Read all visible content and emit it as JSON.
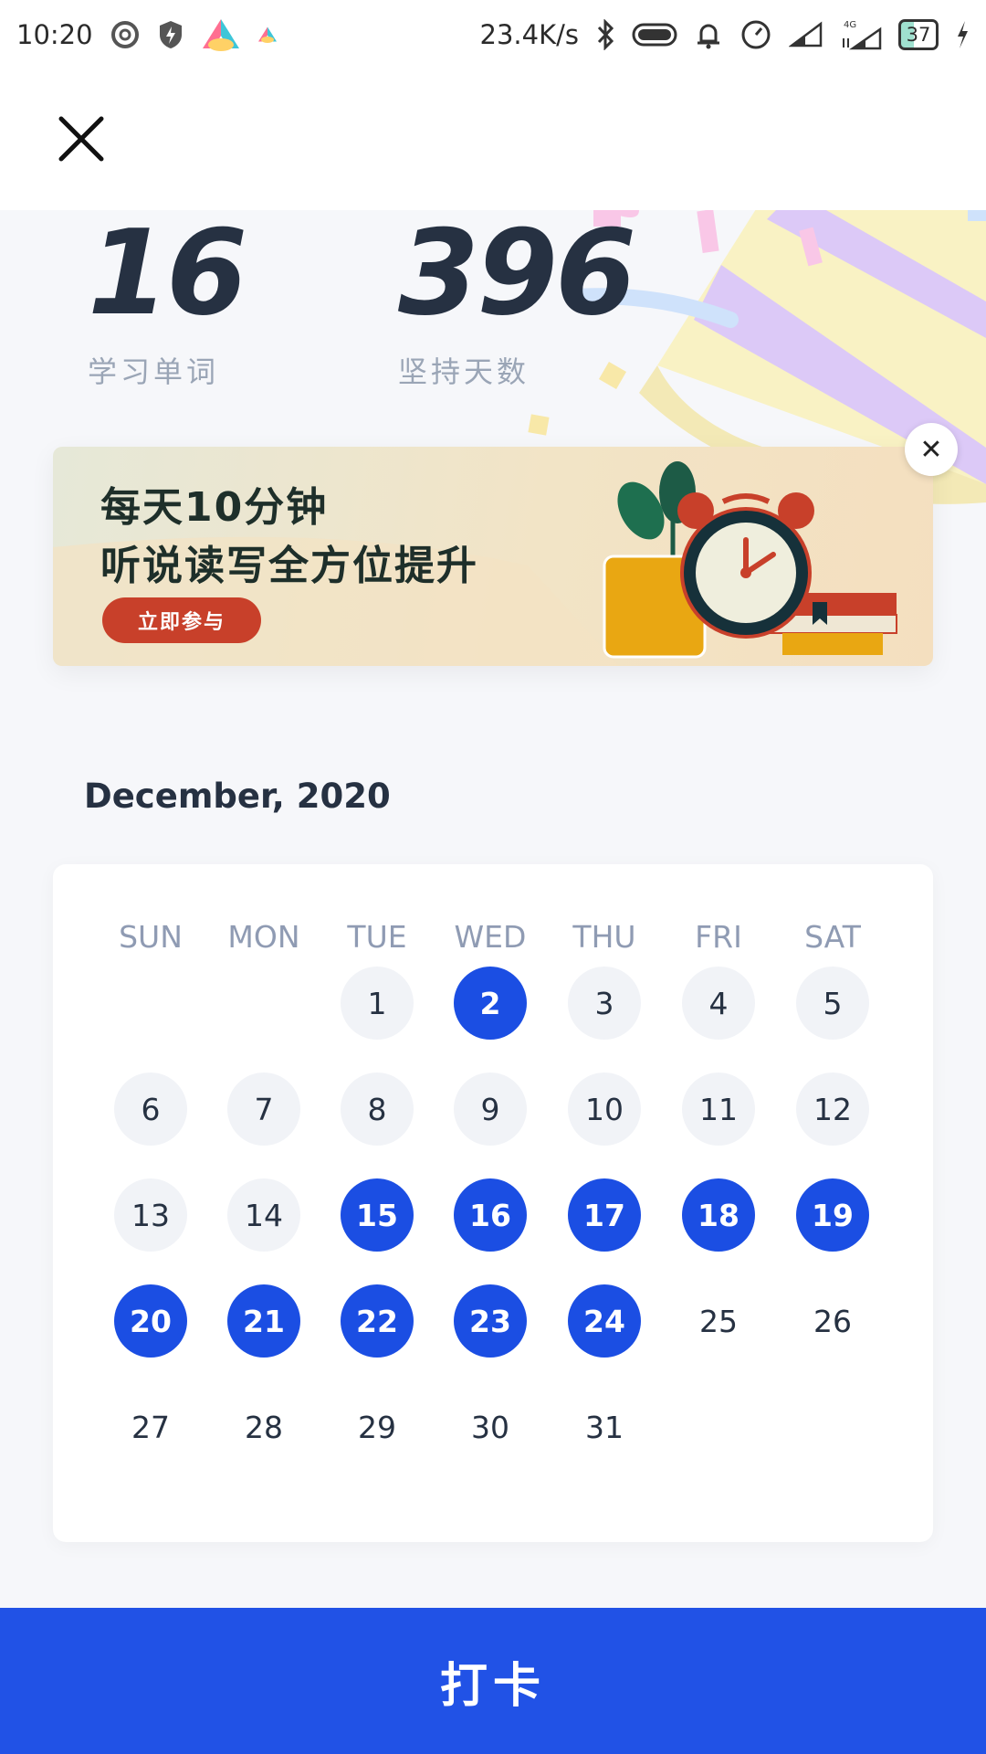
{
  "status_bar": {
    "time": "10:20",
    "net_speed": "23.4K/s",
    "network_label": "4G",
    "battery": "37"
  },
  "stats": {
    "words": {
      "value": "16",
      "label": "学习单词"
    },
    "days": {
      "value": "396",
      "label": "坚持天数"
    }
  },
  "banner": {
    "line1": "每天10分钟",
    "line2": "听说读写全方位提升",
    "cta": "立即参与",
    "close_icon": "close-icon"
  },
  "calendar": {
    "month": "December, 2020",
    "weekdays": [
      "SUN",
      "MON",
      "TUE",
      "WED",
      "THU",
      "FRI",
      "SAT"
    ],
    "first_weekday": 2,
    "days_in_month": 31,
    "today": 24,
    "checked_days": [
      2,
      15,
      16,
      17,
      18,
      19,
      20,
      21,
      22,
      23,
      24
    ],
    "checked_color": "#1b4ee3"
  },
  "checkin_button": {
    "label": "打卡",
    "color": "#2152e6"
  }
}
